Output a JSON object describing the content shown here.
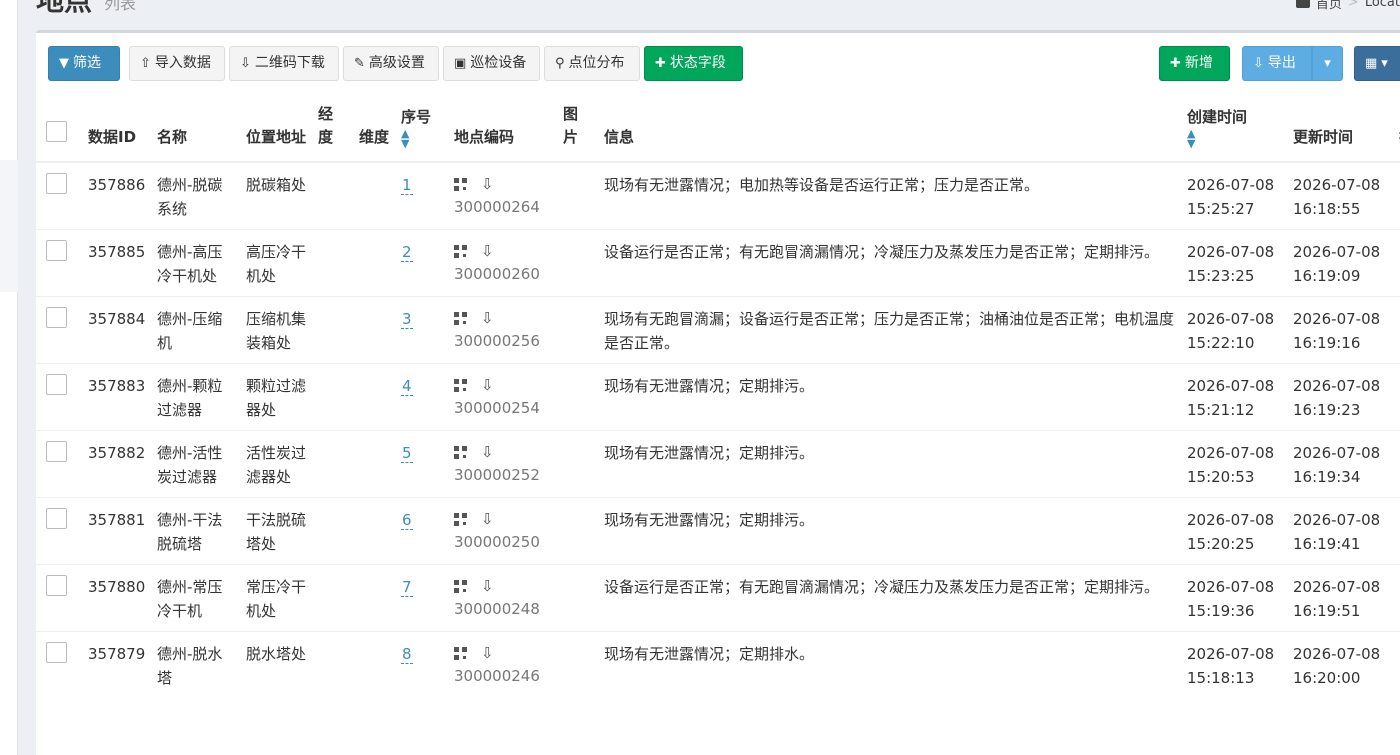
{
  "header": {
    "title": "地点",
    "subtitle": "列表",
    "breadcrumb": [
      "首页",
      "Locat"
    ]
  },
  "toolbar": {
    "filter": "筛选",
    "import": "导入数据",
    "qr_download": "二维码下载",
    "advanced": "高级设置",
    "inspect_device": "巡检设备",
    "point_map": "点位分布",
    "status_field": "状态字段",
    "add": "新增",
    "export": "导出"
  },
  "table": {
    "columns": {
      "id": "数据ID",
      "name": "名称",
      "address": "位置地址",
      "lng": "经度",
      "lat": "维度",
      "seq": "序号",
      "code": "地点编码",
      "image": "图片",
      "info": "信息",
      "created": "创建时间",
      "updated": "更新时间",
      "extra": "操作"
    },
    "rows": [
      {
        "id": "357886",
        "name": "德州-脱碳系统",
        "address": "脱碳箱处",
        "seq": "1",
        "code": "300000264",
        "info": "现场有无泄露情况；电加热等设备是否运行正常；压力是否正常。",
        "created_date": "2026-07-08",
        "created_time": "15:25:27",
        "updated_date": "2026-07-08",
        "updated_time": "16:18:55"
      },
      {
        "id": "357885",
        "name": "德州-高压冷干机处",
        "address": "高压冷干机处",
        "seq": "2",
        "code": "300000260",
        "info": "设备运行是否正常；有无跑冒滴漏情况；冷凝压力及蒸发压力是否正常；定期排污。",
        "created_date": "2026-07-08",
        "created_time": "15:23:25",
        "updated_date": "2026-07-08",
        "updated_time": "16:19:09"
      },
      {
        "id": "357884",
        "name": "德州-压缩机",
        "address": "压缩机集装箱处",
        "seq": "3",
        "code": "300000256",
        "info": "现场有无跑冒滴漏；设备运行是否正常；压力是否正常；油桶油位是否正常；电机温度是否正常。",
        "created_date": "2026-07-08",
        "created_time": "15:22:10",
        "updated_date": "2026-07-08",
        "updated_time": "16:19:16"
      },
      {
        "id": "357883",
        "name": "德州-颗粒过滤器",
        "address": "颗粒过滤器处",
        "seq": "4",
        "code": "300000254",
        "info": "现场有无泄露情况；定期排污。",
        "created_date": "2026-07-08",
        "created_time": "15:21:12",
        "updated_date": "2026-07-08",
        "updated_time": "16:19:23"
      },
      {
        "id": "357882",
        "name": "德州-活性炭过滤器",
        "address": "活性炭过滤器处",
        "seq": "5",
        "code": "300000252",
        "info": "现场有无泄露情况；定期排污。",
        "created_date": "2026-07-08",
        "created_time": "15:20:53",
        "updated_date": "2026-07-08",
        "updated_time": "16:19:34"
      },
      {
        "id": "357881",
        "name": "德州-干法脱硫塔",
        "address": "干法脱硫塔处",
        "seq": "6",
        "code": "300000250",
        "info": "现场有无泄露情况；定期排污。",
        "created_date": "2026-07-08",
        "created_time": "15:20:25",
        "updated_date": "2026-07-08",
        "updated_time": "16:19:41"
      },
      {
        "id": "357880",
        "name": "德州-常压冷干机",
        "address": "常压冷干机处",
        "seq": "7",
        "code": "300000248",
        "info": "设备运行是否正常；有无跑冒滴漏情况；冷凝压力及蒸发压力是否正常；定期排污。",
        "created_date": "2026-07-08",
        "created_time": "15:19:36",
        "updated_date": "2026-07-08",
        "updated_time": "16:19:51"
      },
      {
        "id": "357879",
        "name": "德州-脱水塔",
        "address": "脱水塔处",
        "seq": "8",
        "code": "300000246",
        "info": "现场有无泄露情况；定期排水。",
        "created_date": "2026-07-08",
        "created_time": "15:18:13",
        "updated_date": "2026-07-08",
        "updated_time": "16:20:00"
      }
    ]
  }
}
